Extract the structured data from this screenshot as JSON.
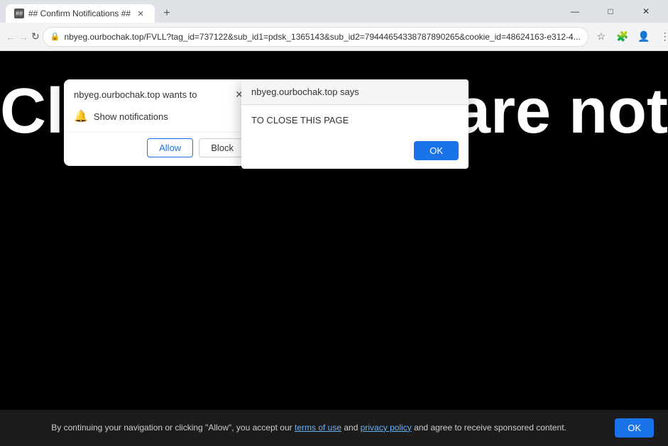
{
  "browser": {
    "tab_title": "## Confirm Notifications ##",
    "url": "nbyeg.ourbochak.top/FVLL?tag_id=737122&sub_id1=pdsk_1365143&sub_id2=79444654338787890265&cookie_id=48624163-e312-4...",
    "new_tab_icon": "+",
    "window_controls": {
      "minimize": "—",
      "maximize": "□",
      "close": "✕"
    },
    "nav": {
      "back": "←",
      "forward": "→",
      "refresh": "↻",
      "lock_icon": "🔒"
    }
  },
  "page": {
    "text_left": "Clic",
    "text_right": "you are not"
  },
  "permission_dialog": {
    "title": "nbyeg.ourbochak.top wants to",
    "close_icon": "✕",
    "notification_text": "Show notifications",
    "allow_label": "Allow",
    "block_label": "Block"
  },
  "site_dialog": {
    "header": "nbyeg.ourbochak.top says",
    "body": "TO CLOSE THIS PAGE",
    "ok_label": "OK"
  },
  "consent_bar": {
    "text_before_terms": "By continuing your navigation or clicking \"Allow\", you accept our ",
    "terms_label": "terms of use",
    "text_between": " and ",
    "privacy_label": "privacy policy",
    "text_after": " and agree to receive sponsored content.",
    "ok_label": "OK"
  }
}
